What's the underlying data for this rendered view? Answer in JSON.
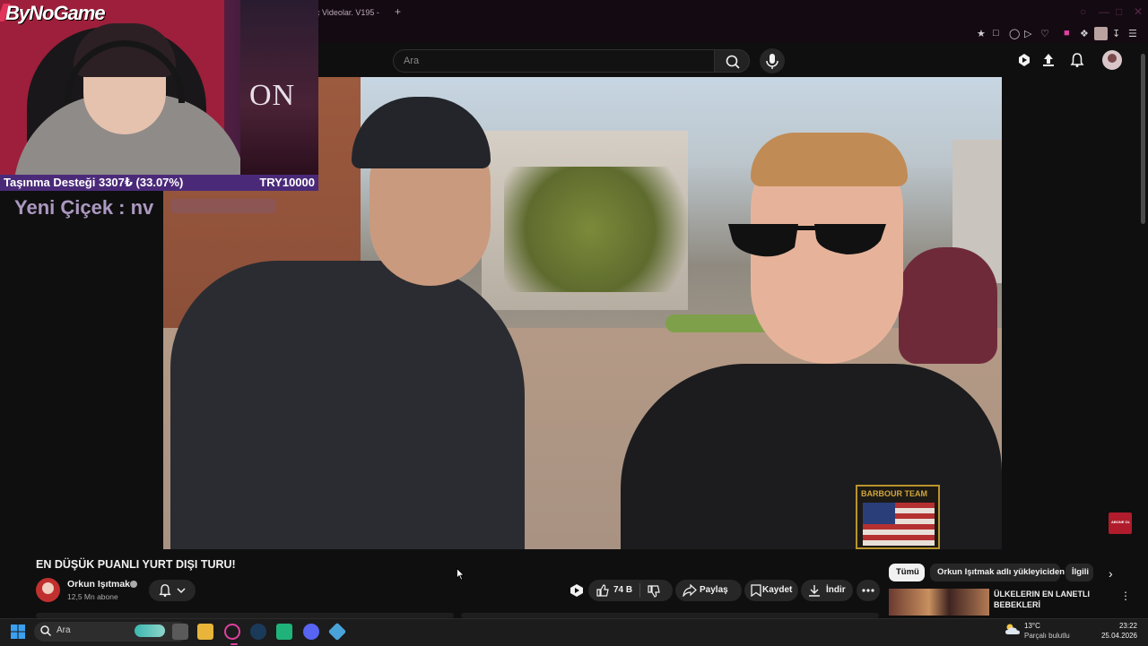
{
  "browser": {
    "tab_title": "ç Videolar. V195 -",
    "new_tab": "+"
  },
  "youtube": {
    "search": {
      "placeholder": "Ara"
    }
  },
  "overlay": {
    "logo": "ByNoGame",
    "poster_text": "ON",
    "donation_label": "Taşınma Desteği 3307₺ (33.07%)",
    "donation_goal": "TRY10000",
    "flower_text": "Yeni Çiçek : nv"
  },
  "video": {
    "title": "EN DÜŞÜK PUANLI YURT DIŞI TURU!",
    "badge_text": "BARBOUR TEAM",
    "watermark": "ABONE OL"
  },
  "channel": {
    "name": "Orkun Işıtmak",
    "subscribers": "12,5 Mn abone"
  },
  "actions": {
    "likes": "74 B",
    "share": "Paylaş",
    "save": "Kaydet",
    "download": "İndir"
  },
  "chips": {
    "all": "Tümü",
    "uploader": "Orkun Işıtmak adlı yükleyiciden",
    "related": "İlgili"
  },
  "related_video": {
    "title_line1": "ÜLKELERIN EN LANETLI",
    "title_line2": "BEBEKLERİ"
  },
  "taskbar": {
    "search_placeholder": "Ara",
    "temperature": "13°C",
    "condition": "Parçalı bulutlu",
    "time": "23:22",
    "date": "25.04.2026"
  },
  "colors": {
    "accent": "#e040a0",
    "donation_bar": "#4a2a78",
    "background": "#0f0f0f"
  }
}
